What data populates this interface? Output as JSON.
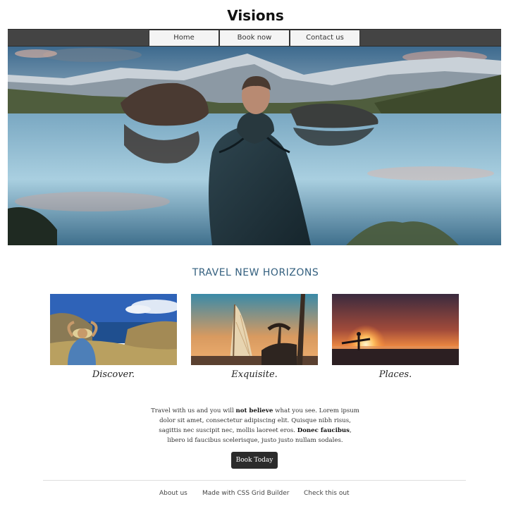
{
  "site": {
    "title": "Visions"
  },
  "nav": {
    "items": [
      "Home",
      "Book now",
      "Contact us"
    ]
  },
  "hero": {
    "image": "mountain-lake-man-photo"
  },
  "section": {
    "heading": "TRAVEL NEW HORIZONS"
  },
  "cards": [
    {
      "caption": "Discover.",
      "image": "coastal-traveler-photo"
    },
    {
      "caption": "Exquisite.",
      "image": "burj-al-arab-photo"
    },
    {
      "caption": "Places.",
      "image": "sunset-surfer-photo"
    }
  ],
  "intro": {
    "part1": "Travel with us and you will ",
    "bold1": "not believe",
    "part2": " what you see. Lorem ipsum dolor sit amet, consectetur adipiscing elit. Quisque nibh risus, sagittis nec suscipit nec, mollis laoreet eros. ",
    "bold2": "Donec faucibus",
    "part3": ", libero id faucibus scelerisque, justo justo nullam sodales."
  },
  "cta": {
    "label": "Book Today"
  },
  "footer": {
    "links": [
      "About us",
      "Made with CSS Grid Builder",
      "Check this out"
    ]
  },
  "colors": {
    "nav_bg": "#444444",
    "heading": "#34607f",
    "button_bg": "#2b2b2b"
  }
}
